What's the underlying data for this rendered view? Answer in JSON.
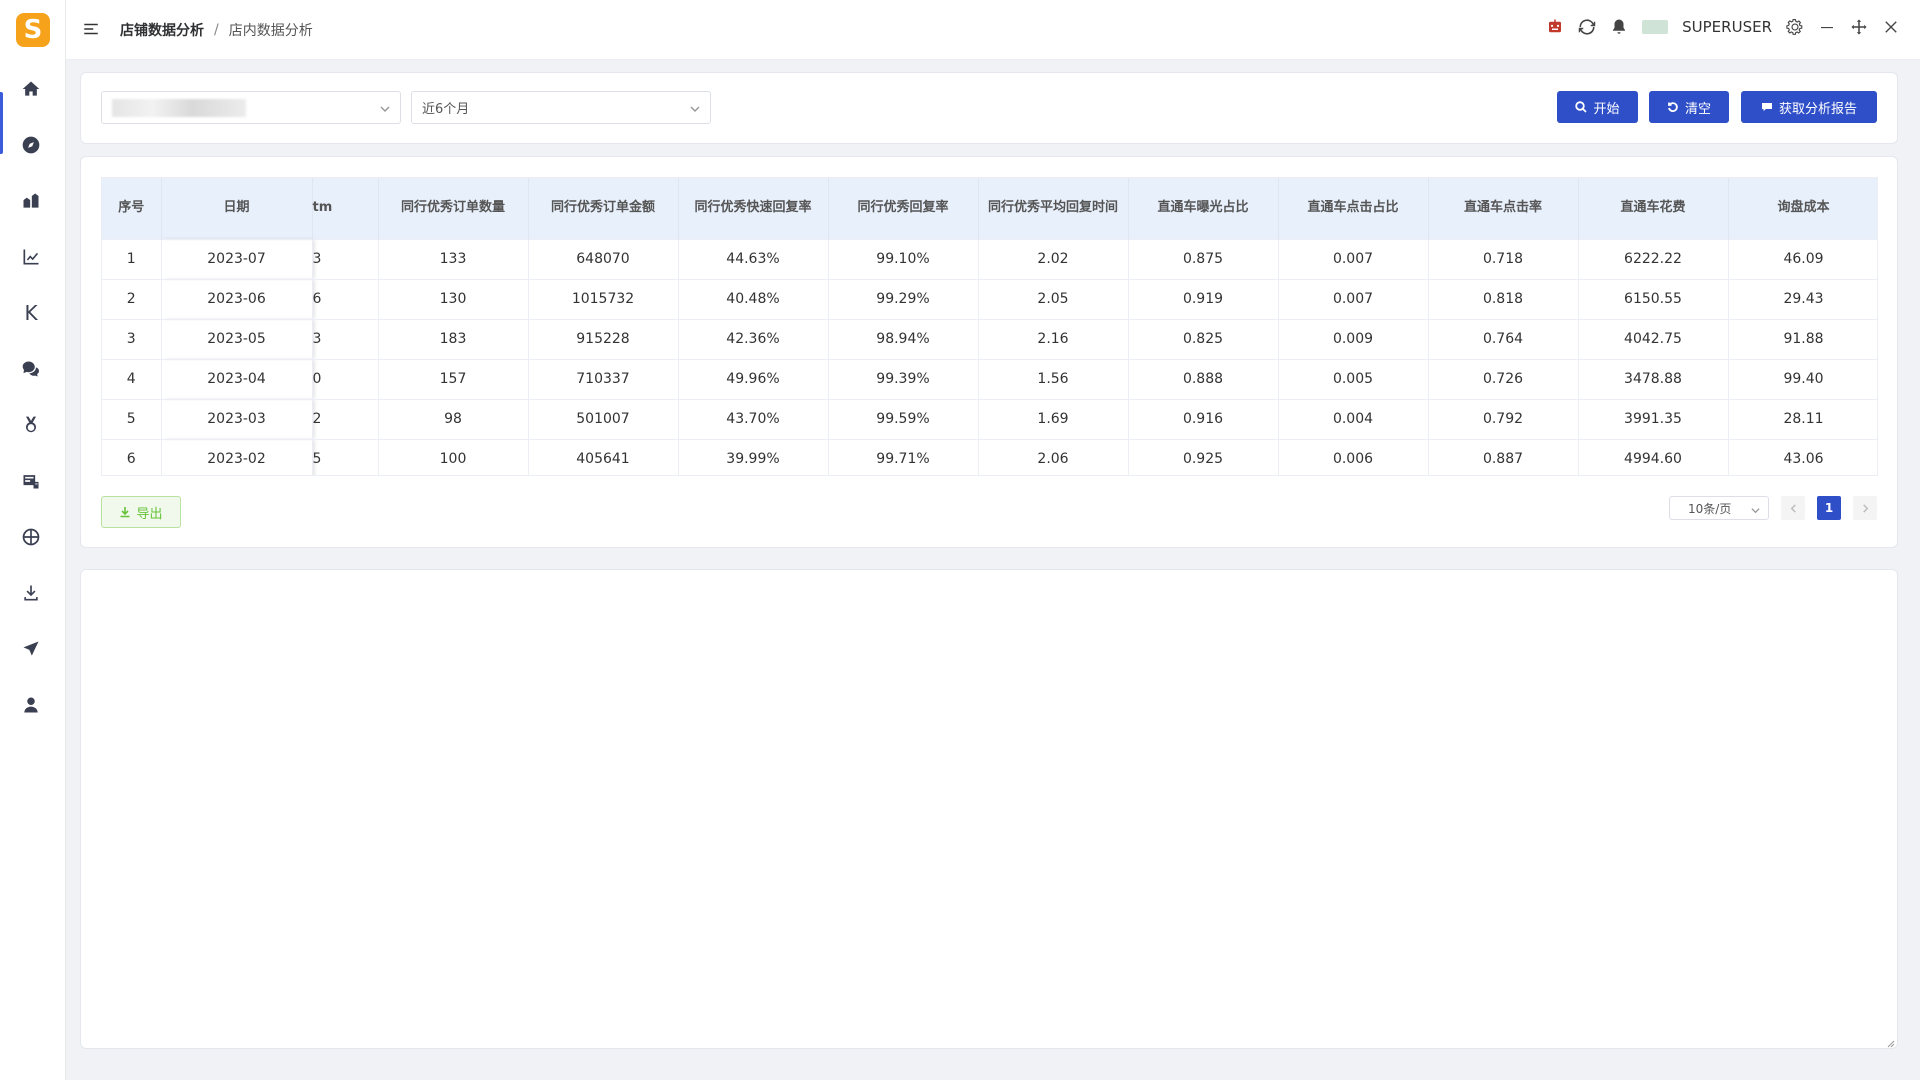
{
  "app": {
    "logo_letter": "S"
  },
  "sidebar": {
    "items": [
      {
        "name": "home-icon"
      },
      {
        "name": "compass-icon"
      },
      {
        "name": "store-analytics-icon"
      },
      {
        "name": "line-chart-icon"
      },
      {
        "name": "k-icon",
        "label": "K"
      },
      {
        "name": "chat-icon"
      },
      {
        "name": "medal-icon"
      },
      {
        "name": "id-card-icon"
      },
      {
        "name": "globe-icon"
      },
      {
        "name": "download-icon"
      },
      {
        "name": "send-icon"
      },
      {
        "name": "user-icon"
      }
    ],
    "accent": "#3b5bdb"
  },
  "header": {
    "breadcrumb_parent": "店铺数据分析",
    "breadcrumb_sep": "/",
    "breadcrumb_current": "店内数据分析",
    "username": "SUPERUSER"
  },
  "filters": {
    "period_value": "近6个月",
    "start_label": "开始",
    "clear_label": "清空",
    "report_label": "获取分析报告"
  },
  "table": {
    "columns": [
      "序号",
      "日期",
      "…tm",
      "同行优秀订单数量",
      "同行优秀订单金额",
      "同行优秀快速回复率",
      "同行优秀回复率",
      "同行优秀平均回复时间",
      "直通车曝光占比",
      "直通车点击占比",
      "直通车点击率",
      "直通车花费",
      "询盘成本"
    ],
    "clipped_header": "tm",
    "rows": [
      [
        "1",
        "2023-07",
        "3",
        "133",
        "648070",
        "44.63%",
        "99.10%",
        "2.02",
        "0.875",
        "0.007",
        "0.718",
        "6222.22",
        "46.09"
      ],
      [
        "2",
        "2023-06",
        "6",
        "130",
        "1015732",
        "40.48%",
        "99.29%",
        "2.05",
        "0.919",
        "0.007",
        "0.818",
        "6150.55",
        "29.43"
      ],
      [
        "3",
        "2023-05",
        "3",
        "183",
        "915228",
        "42.36%",
        "98.94%",
        "2.16",
        "0.825",
        "0.009",
        "0.764",
        "4042.75",
        "91.88"
      ],
      [
        "4",
        "2023-04",
        "0",
        "157",
        "710337",
        "49.96%",
        "99.39%",
        "1.56",
        "0.888",
        "0.005",
        "0.726",
        "3478.88",
        "99.40"
      ],
      [
        "5",
        "2023-03",
        "2",
        "98",
        "501007",
        "43.70%",
        "99.59%",
        "1.69",
        "0.916",
        "0.004",
        "0.792",
        "3991.35",
        "28.11"
      ],
      [
        "6",
        "2023-02",
        "5",
        "100",
        "405641",
        "39.99%",
        "99.71%",
        "2.06",
        "0.925",
        "0.006",
        "0.887",
        "4994.60",
        "43.06"
      ]
    ],
    "header_bg": "#e8f0fb"
  },
  "actions": {
    "export_label": "导出"
  },
  "pagination": {
    "page_size": "10条/页",
    "current_page": "1"
  },
  "colors": {
    "primary": "#2f4fc9",
    "success": "#67c23a",
    "logo": "#f7a21b"
  }
}
